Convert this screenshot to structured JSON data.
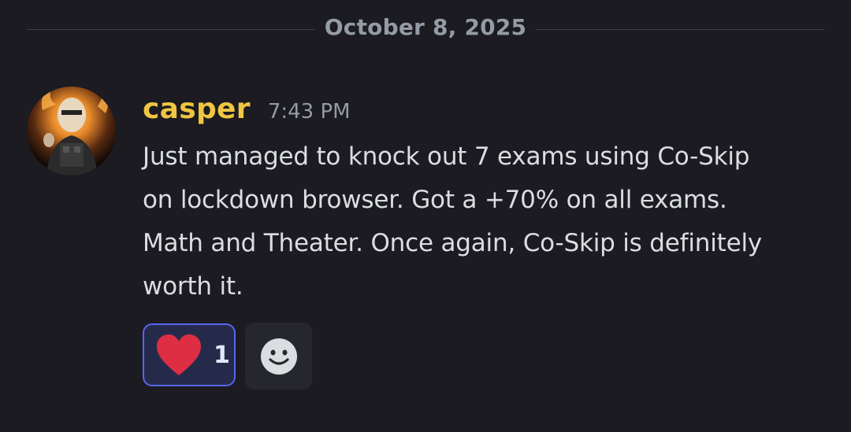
{
  "date_divider": "October 8, 2025",
  "message": {
    "author": "casper",
    "author_color": "#f0c541",
    "timestamp": "7:43 PM",
    "avatar_icon": "user-avatar",
    "lines": [
      "Just managed to knock out 7 exams using Co-Skip",
      "on lockdown browser. Got a +70% on all exams.",
      "Math and Theater. Once again, Co-Skip is definitely",
      "worth it."
    ]
  },
  "reactions": [
    {
      "emoji": "heart-icon",
      "count": "1",
      "highlight_color": "#5865f2"
    }
  ],
  "add_reaction_icon": "smile-icon"
}
